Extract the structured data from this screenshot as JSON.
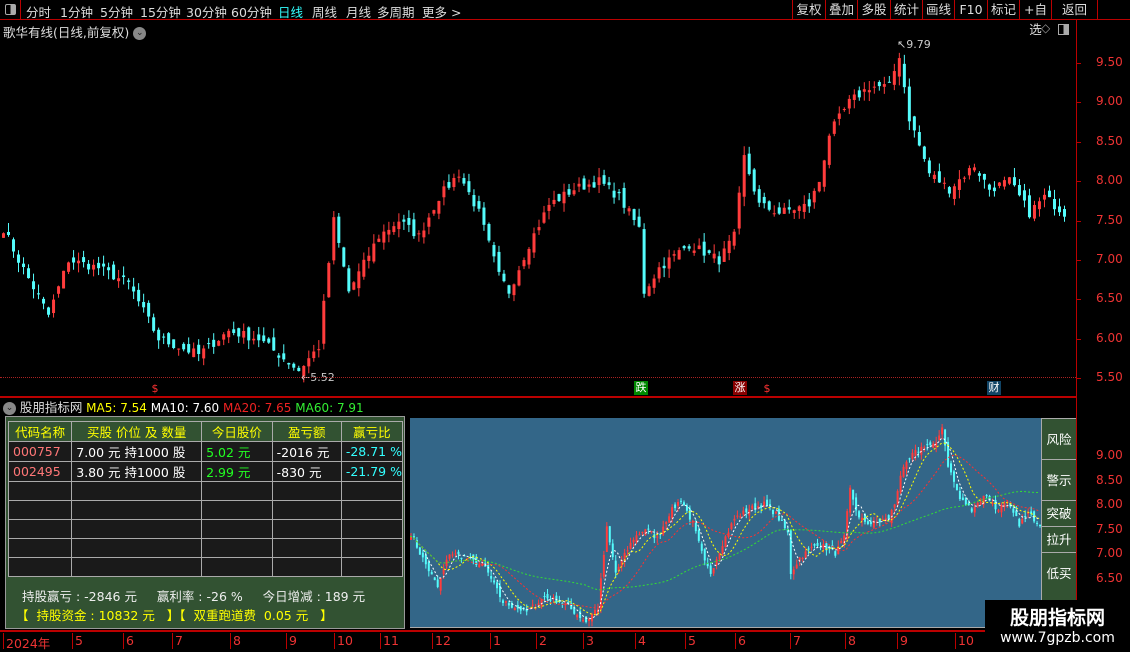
{
  "toolbar": {
    "periods": [
      "分时",
      "1分钟",
      "5分钟",
      "15分钟",
      "30分钟",
      "60分钟",
      "日线",
      "周线",
      "月线",
      "多周期",
      "更多 >"
    ],
    "active": "日线",
    "buttons": [
      "复权",
      "叠加",
      "多股",
      "统计",
      "画线",
      "F10",
      "标记",
      "+自选",
      "返回"
    ]
  },
  "chart_title": "歌华有线(日线,前复权)",
  "price_axis": [
    "9.50",
    "9.00",
    "8.50",
    "8.00",
    "7.50",
    "7.00",
    "6.50",
    "6.00",
    "5.50"
  ],
  "annotations": {
    "high": "9.79",
    "low": "5.52"
  },
  "markers": [
    "$",
    "跌",
    "涨",
    "$",
    "财"
  ],
  "indicator": {
    "name": "股朋指标网",
    "ma5": "MA5: 7.54",
    "ma10": "MA10: 7.60",
    "ma20": "MA20: 7.65",
    "ma60": "MA60: 7.91"
  },
  "table": {
    "headers": [
      "代码名称",
      "买股 价位 及 数量",
      "今日股价",
      "盈亏额",
      "赢亏比"
    ],
    "rows": [
      [
        "000757",
        "7.00 元  持1000 股",
        "5.02 元",
        "-2016 元",
        "-28.71 %"
      ],
      [
        "002495",
        "3.80 元  持1000 股",
        "2.99 元",
        "-830 元",
        "-21.79 %"
      ]
    ]
  },
  "summary": {
    "line1": "持股赢亏 : -2846 元     赢利率 : -26 %     今日增减 : 189 元",
    "line2": "【  持股资金 : 10832 元   】【  双重跑道费  0.05 元   】"
  },
  "side_buttons": [
    "风险",
    "警示",
    "突破",
    "拉升",
    "低买"
  ],
  "inset_axis": [
    "9.00",
    "8.50",
    "8.00",
    "7.50",
    "7.00",
    "6.50"
  ],
  "date_axis": {
    "main": [
      "2024年",
      "5",
      "6",
      "7",
      "8",
      "9",
      "10",
      "11",
      "12",
      "1",
      "2",
      "3",
      "4",
      "5",
      "6",
      "7",
      "8",
      "9",
      "10"
    ]
  },
  "watermark": {
    "name": "股朋指标网",
    "url": "www.7gpzb.com"
  },
  "chart_data": {
    "type": "candlestick",
    "ylim": [
      5.4,
      9.85
    ],
    "close_path": [
      [
        0,
        7.4
      ],
      [
        3,
        7.0
      ],
      [
        9,
        6.3
      ],
      [
        13,
        7.0
      ],
      [
        19,
        6.9
      ],
      [
        25,
        6.7
      ],
      [
        31,
        6.0
      ],
      [
        39,
        5.8
      ],
      [
        45,
        6.1
      ],
      [
        51,
        6.0
      ],
      [
        59,
        5.6
      ],
      [
        63,
        5.9
      ],
      [
        66,
        7.5
      ],
      [
        69,
        6.6
      ],
      [
        75,
        7.3
      ],
      [
        79,
        7.5
      ],
      [
        83,
        7.3
      ],
      [
        87,
        7.8
      ],
      [
        91,
        8.1
      ],
      [
        95,
        7.6
      ],
      [
        99,
        6.8
      ],
      [
        101,
        6.6
      ],
      [
        105,
        7.2
      ],
      [
        109,
        7.7
      ],
      [
        114,
        7.9
      ],
      [
        119,
        8.0
      ],
      [
        123,
        7.8
      ],
      [
        127,
        7.4
      ],
      [
        128,
        6.6
      ],
      [
        131,
        6.9
      ],
      [
        137,
        7.2
      ],
      [
        143,
        7.0
      ],
      [
        146,
        7.3
      ],
      [
        148,
        8.3
      ],
      [
        151,
        7.7
      ],
      [
        155,
        7.6
      ],
      [
        161,
        7.7
      ],
      [
        163,
        8.0
      ],
      [
        165,
        8.6
      ],
      [
        169,
        9.0
      ],
      [
        173,
        9.2
      ],
      [
        177,
        9.2
      ],
      [
        179,
        9.6
      ],
      [
        181,
        8.8
      ],
      [
        185,
        8.1
      ],
      [
        189,
        7.9
      ],
      [
        194,
        8.2
      ],
      [
        197,
        7.9
      ],
      [
        201,
        8.0
      ],
      [
        205,
        7.6
      ],
      [
        208,
        7.8
      ],
      [
        212,
        7.6
      ]
    ],
    "colors": {
      "up": "#ff3c3c",
      "down": "#54fcfc",
      "ma5": "#ffffff",
      "ma10": "#ffff00",
      "ma20": "#ff3030",
      "ma60": "#33dd33"
    }
  }
}
